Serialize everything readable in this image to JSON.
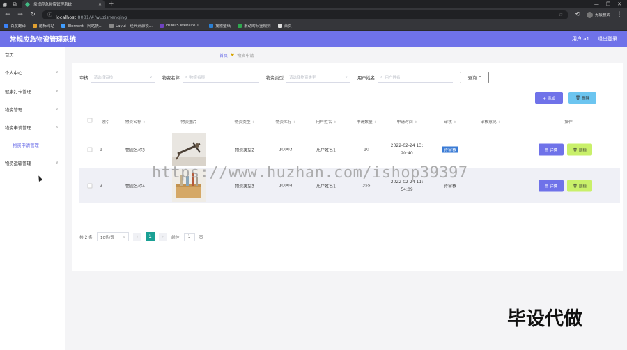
{
  "browser": {
    "tab_title": "常规应急物资管理系统",
    "url_host": "localhost",
    "url_path": ":8081/#/wuzishenqing",
    "profile_label": "无痕模式",
    "bookmarks": [
      "百度翻译",
      "酷标网站",
      "Element - 网站快...",
      "Layui - 经典开源模...",
      "HTML5 Website T...",
      "搜索壁纸",
      "滚动的标签规则",
      "首页"
    ]
  },
  "header": {
    "title": "常规应急物资管理系统",
    "user": "用户 a1",
    "logout": "退出登录"
  },
  "sidebar": {
    "items": [
      {
        "label": "首页"
      },
      {
        "label": "个人中心"
      },
      {
        "label": "健康打卡管理"
      },
      {
        "label": "物资管理"
      },
      {
        "label": "物资申请管理"
      },
      {
        "label": "物资申请管理"
      },
      {
        "label": "物资运输管理"
      }
    ]
  },
  "breadcrumb": {
    "home": "首页",
    "current": "物资申请"
  },
  "search": {
    "label_audit": "审核",
    "placeholder_audit": "请选择审核",
    "label_name": "物资名称",
    "placeholder_name": "物资名称",
    "label_type": "物资类型",
    "placeholder_type": "请选择物资类型",
    "label_user": "用户姓名",
    "placeholder_user": "用户姓名",
    "query_label": "查询"
  },
  "actions": {
    "add_label": "+ 添加",
    "delete_label": "删除"
  },
  "table": {
    "headers": [
      "索引",
      "物资名称",
      "物资图片",
      "物资类型",
      "物资库存",
      "用户姓名",
      "申请数量",
      "申请时间",
      "审核",
      "审核意见",
      "操作"
    ],
    "rows": [
      {
        "index": "1",
        "name": "物资名称3",
        "type": "物资类型2",
        "stock": "10003",
        "user": "用户姓名1",
        "qty": "10",
        "time1": "2022-02-24 13:",
        "time2": "20:40",
        "status": "待审核",
        "detail": "详情",
        "delete": "删除"
      },
      {
        "index": "2",
        "name": "物资名称4",
        "type": "物资类型3",
        "stock": "10004",
        "user": "用户姓名1",
        "qty": "355",
        "time1": "2022-02-24 11:",
        "time2": "54:09",
        "status": "待审核",
        "detail": "详情",
        "delete": "删除"
      }
    ]
  },
  "pagination": {
    "total": "共 2 条",
    "page_size": "10条/页",
    "current_page": "1",
    "goto_label": "前往",
    "goto_value": "1",
    "page_suffix": "页"
  },
  "overlay": {
    "watermark": "https://www.huzhan.com/ishop39397",
    "stamp": "毕设代做"
  },
  "colors": {
    "accent": "#6f72e9",
    "header_bg": "#6f72e9",
    "delete_light": "#c9f06a",
    "batch_delete": "#6cc5f0",
    "pager_active": "#1aa094"
  }
}
